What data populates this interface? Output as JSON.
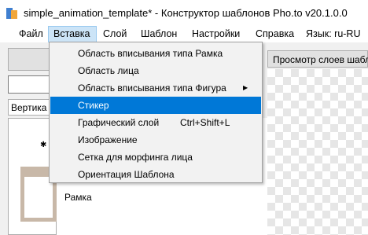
{
  "window": {
    "title": "simple_animation_template* - Конструктор шаблонов Pho.to v20.1.0.0"
  },
  "menubar": {
    "items": [
      {
        "label": "Файл",
        "active": false
      },
      {
        "label": "Вставка",
        "active": true
      },
      {
        "label": "Слой",
        "active": false
      },
      {
        "label": "Шаблон",
        "active": false
      },
      {
        "label": "Настройки",
        "active": false
      },
      {
        "label": "Справка",
        "active": false
      },
      {
        "label": "Язык: ru-RU",
        "active": false
      }
    ]
  },
  "toolbar": {
    "orientation_label": "Вертика",
    "preview_layers_button": "Просмотр слоев шаблона"
  },
  "layer_list": {
    "frame_label": "Рамка"
  },
  "insert_menu": {
    "items": [
      {
        "label": "Область вписывания типа Рамка",
        "shortcut": "",
        "submenu": false,
        "highlighted": false
      },
      {
        "label": "Область лица",
        "shortcut": "",
        "submenu": false,
        "highlighted": false
      },
      {
        "label": "Область вписывания типа Фигура",
        "shortcut": "",
        "submenu": true,
        "highlighted": false
      },
      {
        "label": "Стикер",
        "shortcut": "",
        "submenu": false,
        "highlighted": true
      },
      {
        "label": "Графический слой",
        "shortcut": "Ctrl+Shift+L",
        "submenu": false,
        "highlighted": false
      },
      {
        "label": "Изображение",
        "shortcut": "",
        "submenu": false,
        "highlighted": false
      },
      {
        "label": "Сетка для морфинга лица",
        "shortcut": "",
        "submenu": false,
        "highlighted": false
      },
      {
        "label": "Ориентация Шаблона",
        "shortcut": "",
        "submenu": false,
        "highlighted": false
      }
    ]
  },
  "icons": {
    "app": "app-icon",
    "submenu": "chevron-right-icon"
  },
  "colors": {
    "highlight": "#0078d7",
    "menu_active": "#cce4f7"
  }
}
